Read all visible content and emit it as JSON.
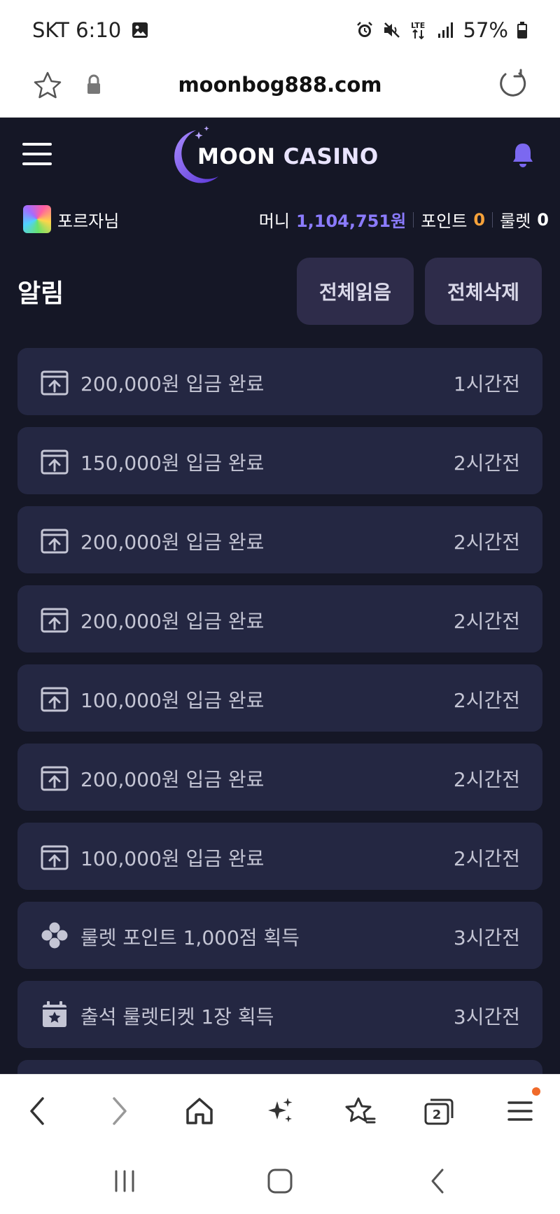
{
  "status_bar": {
    "carrier_time": "SKT 6:10",
    "network": "LTE",
    "battery": "57%"
  },
  "browser": {
    "url": "moonbog888.com",
    "tab_count": "2"
  },
  "site": {
    "logo_part1": "MOON ",
    "logo_part2": "CASINO",
    "username": "포르자님",
    "money_label": "머니",
    "money_value": "1,104,751원",
    "point_label": "포인트",
    "point_value": "0",
    "roulette_label": "룰렛",
    "roulette_value": "0",
    "page_title": "알림",
    "read_all_label": "전체읽음",
    "delete_all_label": "전체삭제"
  },
  "notifications": [
    {
      "icon": "deposit-icon",
      "text": "200,000원 입금 완료",
      "time": "1시간전"
    },
    {
      "icon": "deposit-icon",
      "text": "150,000원 입금 완료",
      "time": "2시간전"
    },
    {
      "icon": "deposit-icon",
      "text": "200,000원 입금 완료",
      "time": "2시간전"
    },
    {
      "icon": "deposit-icon",
      "text": "200,000원 입금 완료",
      "time": "2시간전"
    },
    {
      "icon": "deposit-icon",
      "text": "100,000원 입금 완료",
      "time": "2시간전"
    },
    {
      "icon": "deposit-icon",
      "text": "200,000원 입금 완료",
      "time": "2시간전"
    },
    {
      "icon": "deposit-icon",
      "text": "100,000원 입금 완료",
      "time": "2시간전"
    },
    {
      "icon": "roulette-point-icon",
      "text": "룰렛 포인트 1,000점 획득",
      "time": "3시간전"
    },
    {
      "icon": "attendance-calendar-icon",
      "text": "출석 룰렛티켓 1장 획득",
      "time": "3시간전"
    },
    {
      "icon": "",
      "text": "",
      "time": ""
    }
  ],
  "colors": {
    "site_bg": "#151726",
    "card_bg": "#242742",
    "button_bg": "#2e2c4a",
    "money_accent": "#8b7bff",
    "point_accent": "#f6a23a",
    "bell": "#7b68f0"
  }
}
